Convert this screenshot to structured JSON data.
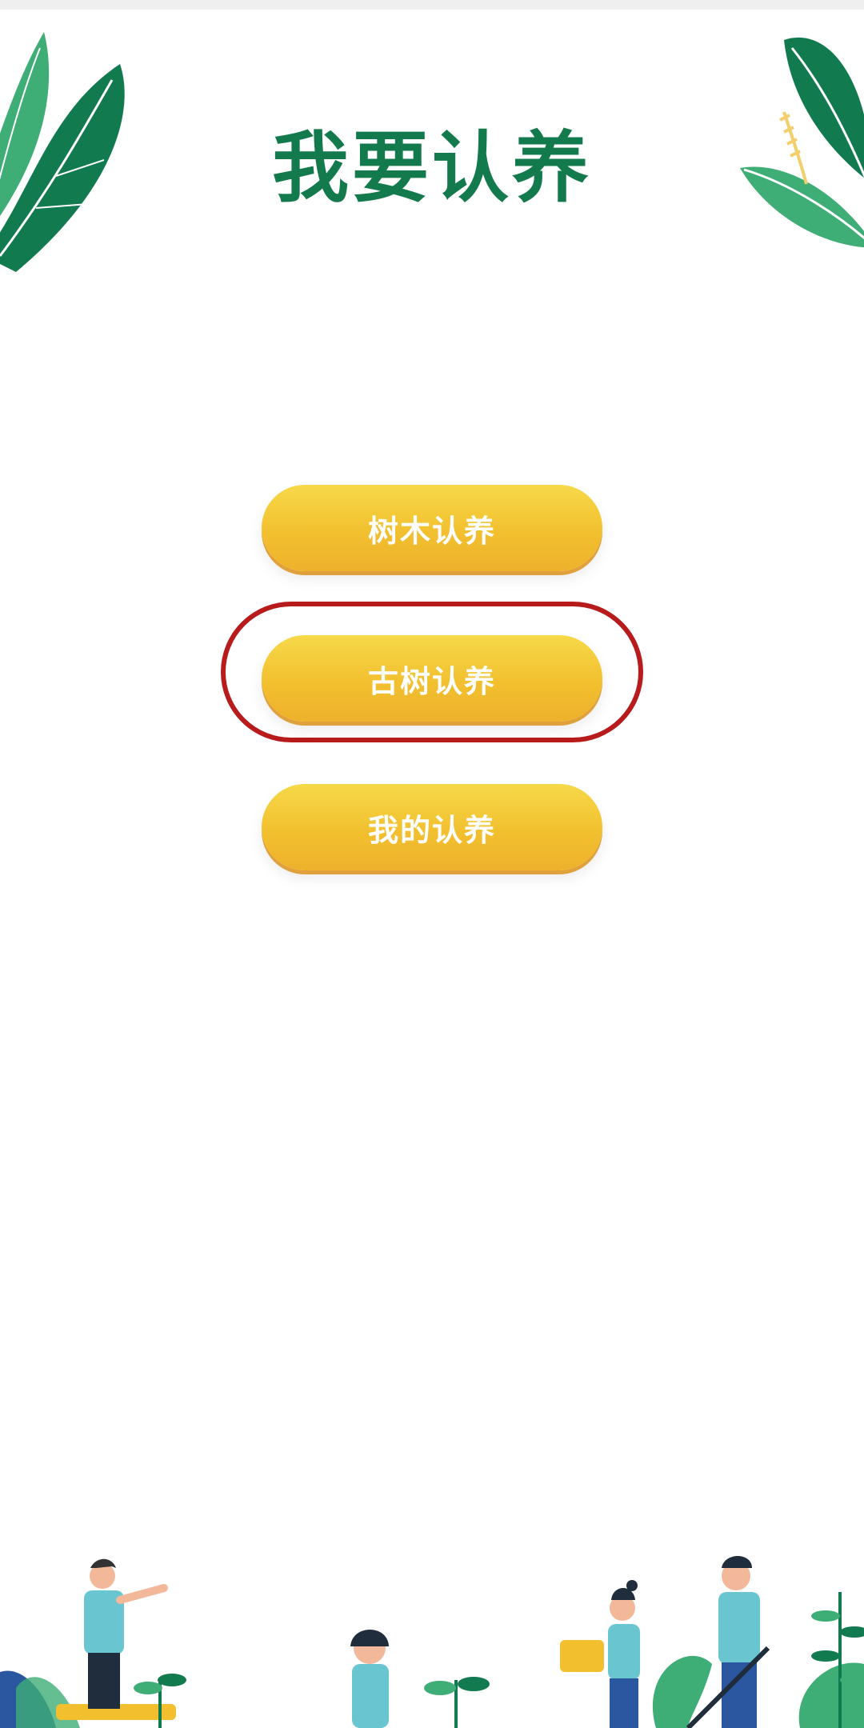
{
  "header": {
    "title": "我要认养"
  },
  "menu": {
    "items": [
      {
        "label": "树木认养"
      },
      {
        "label": "古树认养"
      },
      {
        "label": "我的认养"
      }
    ]
  },
  "decorations": {
    "top_left": "leaf-icon",
    "top_right": "leaf-icon",
    "bottom": "gardeners-illustration"
  },
  "colors": {
    "title": "#137a4d",
    "button_gradient_top": "#f6d949",
    "button_gradient_bottom": "#eeb12c",
    "highlight_ring": "#b81b1b",
    "leaf_dark": "#127a4f",
    "leaf_light": "#3fae76"
  }
}
